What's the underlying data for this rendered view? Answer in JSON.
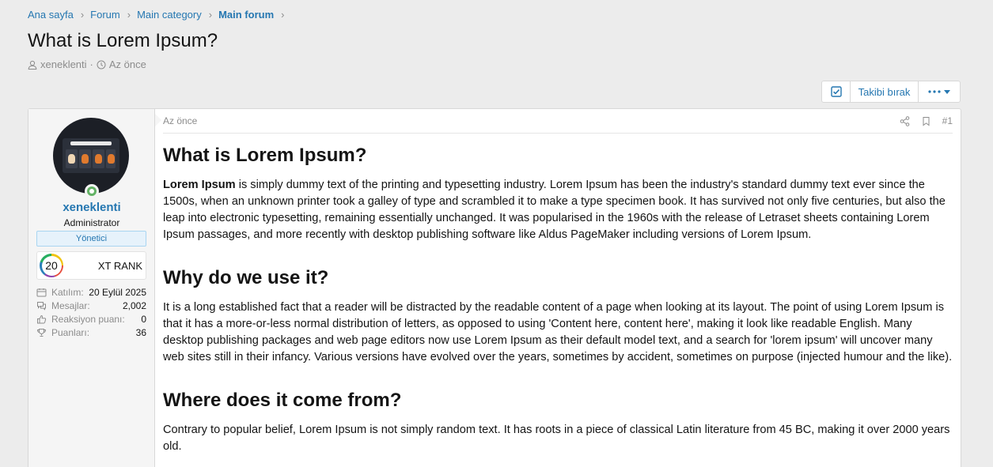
{
  "breadcrumb": {
    "items": [
      "Ana sayfa",
      "Forum",
      "Main category"
    ],
    "current": "Main forum"
  },
  "thread": {
    "title": "What is Lorem Ipsum?",
    "author": "xeneklenti",
    "time": "Az önce"
  },
  "actions": {
    "unwatch_label": "Takibi bırak"
  },
  "user": {
    "name": "xeneklenti",
    "title": "Administrator",
    "banner": "Yönetici",
    "rank_level": "20",
    "rank_label": "XT RANK",
    "stats": [
      {
        "icon": "calendar-icon",
        "label": "Katılım:",
        "value": "20 Eylül 2025"
      },
      {
        "icon": "messages-icon",
        "label": "Mesajlar:",
        "value": "2,002"
      },
      {
        "icon": "thumbs-up-icon",
        "label": "Reaksiyon puanı:",
        "value": "0"
      },
      {
        "icon": "trophy-icon",
        "label": "Puanları:",
        "value": "36"
      }
    ]
  },
  "post": {
    "time": "Az önce",
    "number": "#1",
    "h1": "What is Lorem Ipsum?",
    "p1_bold": "Lorem Ipsum",
    "p1": " is simply dummy text of the printing and typesetting industry. Lorem Ipsum has been the industry's standard dummy text ever since the 1500s, when an unknown printer took a galley of type and scrambled it to make a type specimen book. It has survived not only five centuries, but also the leap into electronic typesetting, remaining essentially unchanged. It was popularised in the 1960s with the release of Letraset sheets containing Lorem Ipsum passages, and more recently with desktop publishing software like Aldus PageMaker including versions of Lorem Ipsum.",
    "h2": "Why do we use it?",
    "p2": "It is a long established fact that a reader will be distracted by the readable content of a page when looking at its layout. The point of using Lorem Ipsum is that it has a more-or-less normal distribution of letters, as opposed to using 'Content here, content here', making it look like readable English. Many desktop publishing packages and web page editors now use Lorem Ipsum as their default model text, and a search for 'lorem ipsum' will uncover many web sites still in their infancy. Various versions have evolved over the years, sometimes by accident, sometimes on purpose (injected humour and the like).",
    "h3": "Where does it come from?",
    "p3": "Contrary to popular belief, Lorem Ipsum is not simply random text. It has roots in a piece of classical Latin literature from 45 BC, making it over 2000 years old."
  },
  "colors": {
    "link": "#2577b1",
    "background": "#ececec",
    "online": "#63b265"
  }
}
